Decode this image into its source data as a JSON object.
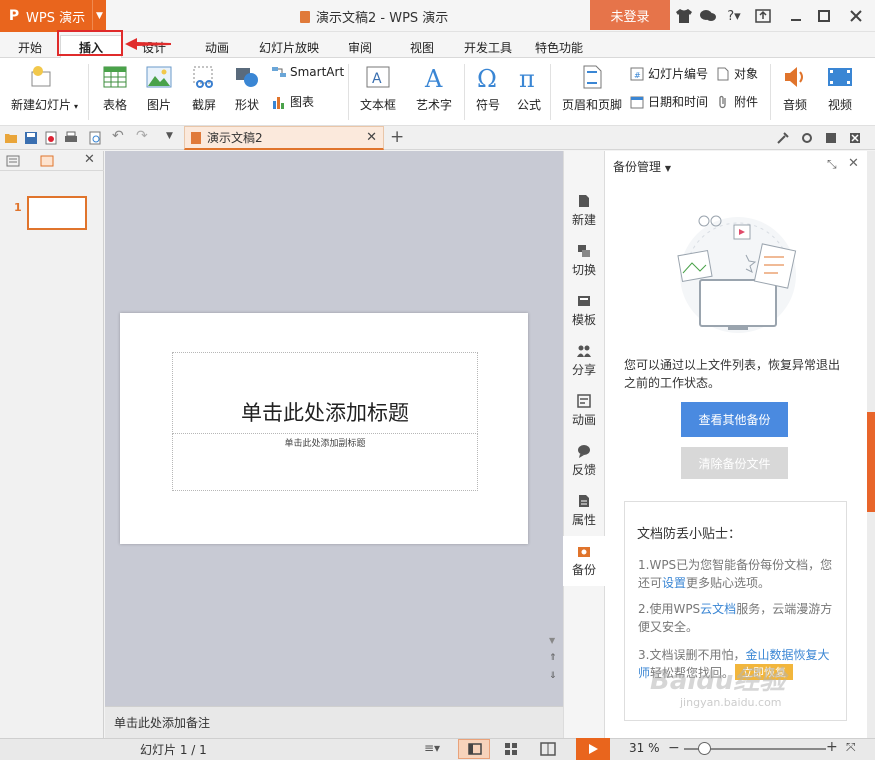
{
  "app": {
    "name": "WPS 演示",
    "logo": "P",
    "accent": "#e9651d"
  },
  "window": {
    "title": "演示文稿2 - WPS 演示",
    "login": "未登录"
  },
  "menu": {
    "tabs": [
      {
        "label": "开始"
      },
      {
        "label": "插入"
      },
      {
        "label": "设计"
      },
      {
        "label": "动画"
      },
      {
        "label": "幻灯片放映"
      },
      {
        "label": "审阅"
      },
      {
        "label": "视图"
      },
      {
        "label": "开发工具"
      },
      {
        "label": "特色功能"
      }
    ],
    "active": "插入"
  },
  "ribbon": {
    "new_slide": "新建幻灯片",
    "table": "表格",
    "picture": "图片",
    "screenshot": "截屏",
    "shape": "形状",
    "smartart": "SmartArt",
    "chart": "图表",
    "textbox": "文本框",
    "wordart": "艺术字",
    "symbol": "符号",
    "formula": "公式",
    "header_footer": "页眉和页脚",
    "slide_number": "幻灯片编号",
    "datetime": "日期和时间",
    "object": "对象",
    "attachment": "附件",
    "audio": "音频",
    "video": "视频"
  },
  "document_tab": {
    "label": "演示文稿2"
  },
  "slides": {
    "current_number": "1"
  },
  "slide": {
    "title_placeholder": "单击此处添加标题",
    "subtitle_placeholder": "单击此处添加副标题"
  },
  "notes": {
    "placeholder": "单击此处添加备注"
  },
  "side_tabs": [
    {
      "label": "新建"
    },
    {
      "label": "切换"
    },
    {
      "label": "模板"
    },
    {
      "label": "分享"
    },
    {
      "label": "动画"
    },
    {
      "label": "反馈"
    },
    {
      "label": "属性"
    },
    {
      "label": "备份"
    }
  ],
  "backup_panel": {
    "title": "备份管理",
    "description": "您可以通过以上文件列表，恢复异常退出之前的工作状态。",
    "view_button": "查看其他备份",
    "clear_button": "清除备份文件",
    "tips_title": "文档防丢小贴士：",
    "tip1_a": "1.WPS已为您智能备份每份文档，您还可",
    "tip1_link": "设置",
    "tip1_b": "更多贴心选项。",
    "tip2_a": "2.使用WPS",
    "tip2_link": "云文档",
    "tip2_b": "服务，云端漫游方便又安全。",
    "tip3_a": "3.文档误删不用怕，",
    "tip3_link": "金山数据恢复大师",
    "tip3_b": "轻松帮您找回。",
    "restore_button": "立即恢复"
  },
  "status": {
    "slide_info": "幻灯片 1 / 1",
    "zoom": "31 %",
    "zoom_level_pct": 31
  },
  "watermark": {
    "brand": "Baidu经验",
    "url": "jingyan.baidu.com"
  }
}
